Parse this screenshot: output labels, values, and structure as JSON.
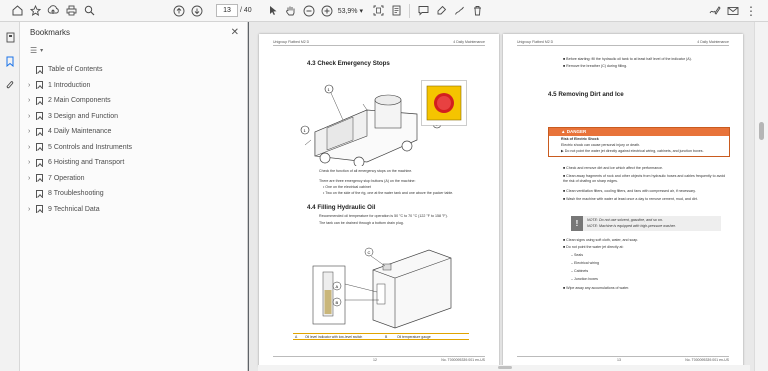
{
  "toolbar": {
    "page_current": "13",
    "page_total": "/ 40",
    "zoom": "53,9%",
    "icons": [
      "home-icon",
      "bookmark-star-icon",
      "upload-icon",
      "print-icon",
      "search-icon",
      "page-up-icon",
      "page-down-icon",
      "select-cursor-icon",
      "hand-tool-icon",
      "zoom-out-icon",
      "zoom-in-icon",
      "fit-page-icon",
      "scroll-mode-icon",
      "comment-icon",
      "highlight-icon",
      "pen-icon",
      "delete-icon",
      "sign-icon",
      "email-icon",
      "more-icon"
    ]
  },
  "bookmarks": {
    "title": "Bookmarks",
    "items": [
      {
        "label": "Table of Contents",
        "expandable": false
      },
      {
        "label": "1 Introduction",
        "expandable": true
      },
      {
        "label": "2 Main Components",
        "expandable": true
      },
      {
        "label": "3 Design and Function",
        "expandable": true
      },
      {
        "label": "4 Daily Maintenance",
        "expandable": true
      },
      {
        "label": "5 Controls and Instruments",
        "expandable": true
      },
      {
        "label": "6 Hoisting and Transport",
        "expandable": true
      },
      {
        "label": "7 Operation",
        "expandable": true
      },
      {
        "label": "8 Troubleshooting",
        "expandable": false
      },
      {
        "label": "9 Technical Data",
        "expandable": true
      }
    ]
  },
  "left_page": {
    "header_left": "Unigroup Flatbed M2 D",
    "header_right": "4 Daily Maintenance",
    "sec_43": "4.3  Check Emergency Stops",
    "check_text": "Check the function of all emergency stops on the machine.",
    "three_stops": "There are three emergency stop buttons (A) on the machine:",
    "bullet_1": "One on the electrical cabinet",
    "bullet_2": "Two on the side of the rig, one at the water tank and one above the pucker table.",
    "sec_44": "4.4  Filling Hydraulic Oil",
    "temp_text": "Recommended oil temperature for operation is 50 °C to 70 °C (122 °F to 158 °F).",
    "drain_text": "The tank can be drained through a bottom drain plug.",
    "label_a": "A",
    "label_a_text": "Oil level indicator with low-level switch",
    "label_b": "B",
    "label_b_text": "Oil temperature gauge",
    "footer_left": "12",
    "footer_right": "No. T000095339.001 en-US"
  },
  "right_page": {
    "header_left": "Unigroup Flatbed M2 D",
    "header_right": "4 Daily Maintenance",
    "top_b1": "Before starting: fill the hydraulic oil tank to at least half level of the indicator (A).",
    "top_b2": "Remove the breather (C) during filling.",
    "sec_45": "4.5  Removing Dirt and Ice",
    "danger": "DANGER",
    "danger_title": "Risk of Electric Shock",
    "danger_l1": "Electric shock can cause personal injury or death.",
    "danger_l2": "Do not point the water jet directly against electrical wiring, cabinets, and junction boxes.",
    "b1": "Check and remove dirt and ice which affect the performance.",
    "b2": "Clean away fragments of rock and other objects from hydraulic hoses and cables frequently to avoid the risk of chafing on sharp edges.",
    "b3": "Clean ventilation filters, cooling filters, and fans with compressed air, if necessary.",
    "b4": "Wash the machine with water at least once a day to remove cement, mud, and dirt.",
    "note_l1": "NOTE: Do not use solvent, gasoline, and so on.",
    "note_l2": "NOTE: Machine is equipped with high-pressure washer.",
    "b5": "Clean signs using soft cloth, water, and soap.",
    "b6": "Do not point the water jet directly at:",
    "s1": "Seals",
    "s2": "Electrical wiring",
    "s3": "Cabinets",
    "s4": "Junction boxes",
    "b7": "Wipe away any accumulations of water.",
    "footer_left": "13",
    "footer_right": "No. T000095339.001 en-US"
  }
}
